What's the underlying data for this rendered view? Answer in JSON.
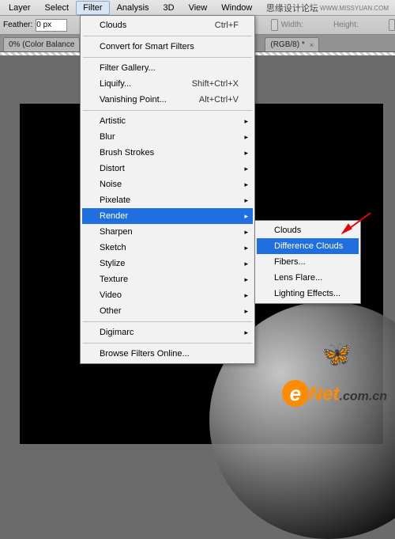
{
  "menubar": {
    "items": [
      "Layer",
      "Select",
      "Filter",
      "Analysis",
      "3D",
      "View",
      "Window"
    ],
    "active_index": 2
  },
  "toolbar": {
    "feather_label": "Feather:",
    "feather_value": "0 px",
    "width_label": "Width:",
    "height_label": "Height:"
  },
  "tabs": {
    "left": {
      "label": "0% (Color Balance"
    },
    "right": {
      "label": "(RGB/8) *",
      "close": "×"
    }
  },
  "watermark": {
    "cn": "思缘设计论坛",
    "url": "WWW.MISSYUAN.COM"
  },
  "filter_menu": {
    "clouds": "Clouds",
    "clouds_sc": "Ctrl+F",
    "convert": "Convert for Smart Filters",
    "gallery": "Filter Gallery...",
    "liquify": "Liquify...",
    "liquify_sc": "Shift+Ctrl+X",
    "vanish": "Vanishing Point...",
    "vanish_sc": "Alt+Ctrl+V",
    "artistic": "Artistic",
    "blur": "Blur",
    "brush": "Brush Strokes",
    "distort": "Distort",
    "noise": "Noise",
    "pixelate": "Pixelate",
    "render": "Render",
    "sharpen": "Sharpen",
    "sketch": "Sketch",
    "stylize": "Stylize",
    "texture": "Texture",
    "video": "Video",
    "other": "Other",
    "digimarc": "Digimarc",
    "browse": "Browse Filters Online..."
  },
  "render_submenu": {
    "clouds": "Clouds",
    "diff": "Difference Clouds",
    "fibers": "Fibers...",
    "lens": "Lens Flare...",
    "lighting": "Lighting Effects..."
  },
  "arrow_glyph": "▸",
  "logo": {
    "e": "e",
    "net": "Net",
    "com": ".com.cn"
  },
  "butterfly": "🦋"
}
